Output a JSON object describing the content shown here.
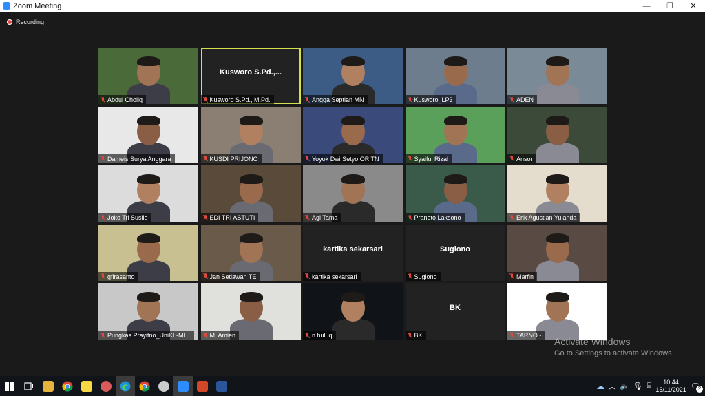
{
  "window": {
    "title": "Zoom Meeting",
    "minimize": "—",
    "maximize": "❐",
    "close": "✕"
  },
  "recording": {
    "label": "Recording"
  },
  "participants": [
    {
      "name": "Abdul Choliq",
      "video": true,
      "bg": "#4a6a3a"
    },
    {
      "name": "Kusworo S.Pd., M.Pd.",
      "video": false,
      "display": "Kusworo  S.Pd.,...",
      "active": true
    },
    {
      "name": "Angga Septian MN",
      "video": true,
      "bg": "#3c5c86"
    },
    {
      "name": "Kusworo_LP3",
      "video": true,
      "bg": "#6d7d8d"
    },
    {
      "name": "ADEN",
      "video": true,
      "bg": "#7a8a96"
    },
    {
      "name": "Dameis Surya Anggara",
      "video": true,
      "bg": "#e8e8e8"
    },
    {
      "name": "KUSDI PRIJONO",
      "video": true,
      "bg": "#8a7f72"
    },
    {
      "name": "Yoyok Dwi Setyo OR TN",
      "video": true,
      "bg": "#3a4a7a"
    },
    {
      "name": "Syaiful Rizal",
      "video": true,
      "bg": "#5aa05a"
    },
    {
      "name": "Ansor",
      "video": true,
      "bg": "#3c4a3a"
    },
    {
      "name": "Joko Tri Susilo",
      "video": true,
      "bg": "#dcdcdc"
    },
    {
      "name": "EDI TRI ASTUTI",
      "video": true,
      "bg": "#5a4a3a"
    },
    {
      "name": "Agi Tama",
      "video": true,
      "bg": "#8a8a8a"
    },
    {
      "name": "Pranoto Laksono",
      "video": true,
      "bg": "#3a5a4a"
    },
    {
      "name": "Erik Agustian Yulanda",
      "video": true,
      "bg": "#e4dccc"
    },
    {
      "name": "gfirasanto",
      "video": true,
      "bg": "#c8c090"
    },
    {
      "name": "Jan Setiawan TE",
      "video": true,
      "bg": "#6a5a4a"
    },
    {
      "name": "kartika sekarsari",
      "video": false,
      "display": "kartika sekarsari"
    },
    {
      "name": "Sugiono",
      "video": false,
      "display": "Sugiono"
    },
    {
      "name": "Marfin",
      "video": true,
      "bg": "#5a4a44"
    },
    {
      "name": "Pungkas Prayitno_UniKL-MI...",
      "video": true,
      "bg": "#c8c8c8"
    },
    {
      "name": "M. Amien",
      "video": true,
      "bg": "#e0e0dc"
    },
    {
      "name": "n huluq",
      "video": true,
      "bg": "#101418"
    },
    {
      "name": "BK",
      "video": false,
      "display": "BK"
    },
    {
      "name": "TARNO -",
      "video": true,
      "bg": "#ffffff"
    }
  ],
  "activation": {
    "title": "Activate Windows",
    "subtitle": "Go to Settings to activate Windows."
  },
  "taskbar": {
    "apps": [
      "windows-start",
      "task-view",
      "file-explorer",
      "chrome",
      "sticky-notes",
      "snipping",
      "edge",
      "chrome-2",
      "vlc",
      "zoom",
      "powerpoint",
      "word"
    ],
    "clock_time": "10:44",
    "clock_date": "15/11/2021",
    "notification_count": "2"
  }
}
